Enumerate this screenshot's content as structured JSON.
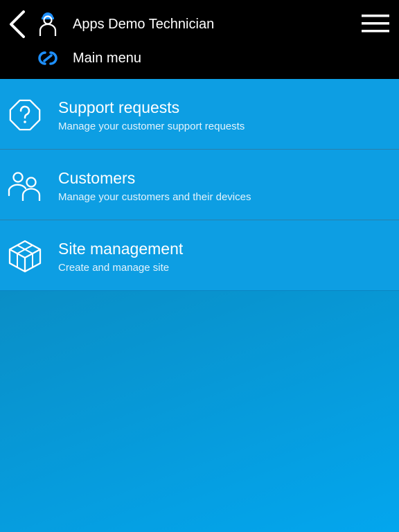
{
  "header": {
    "title": "Apps Demo Technician",
    "subtitle": "Main menu",
    "back_icon": "chevron-left-icon",
    "user_icon": "technician-user-icon",
    "logo_icon": "app-logo-icon",
    "menu_icon": "hamburger-menu-icon"
  },
  "menu": {
    "items": [
      {
        "title": "Support requests",
        "description": "Manage your customer support requests",
        "icon": "question-octagon-icon"
      },
      {
        "title": "Customers",
        "description": "Manage your customers and their devices",
        "icon": "users-icon"
      },
      {
        "title": "Site management",
        "description": "Create and manage site",
        "icon": "cube-icon"
      }
    ]
  },
  "colors": {
    "header_bg": "#000000",
    "item_bg": "#0d9ee3",
    "accent_blue": "#1e90ff",
    "background_top": "#0a7bab",
    "background_bottom": "#03a6ee"
  }
}
